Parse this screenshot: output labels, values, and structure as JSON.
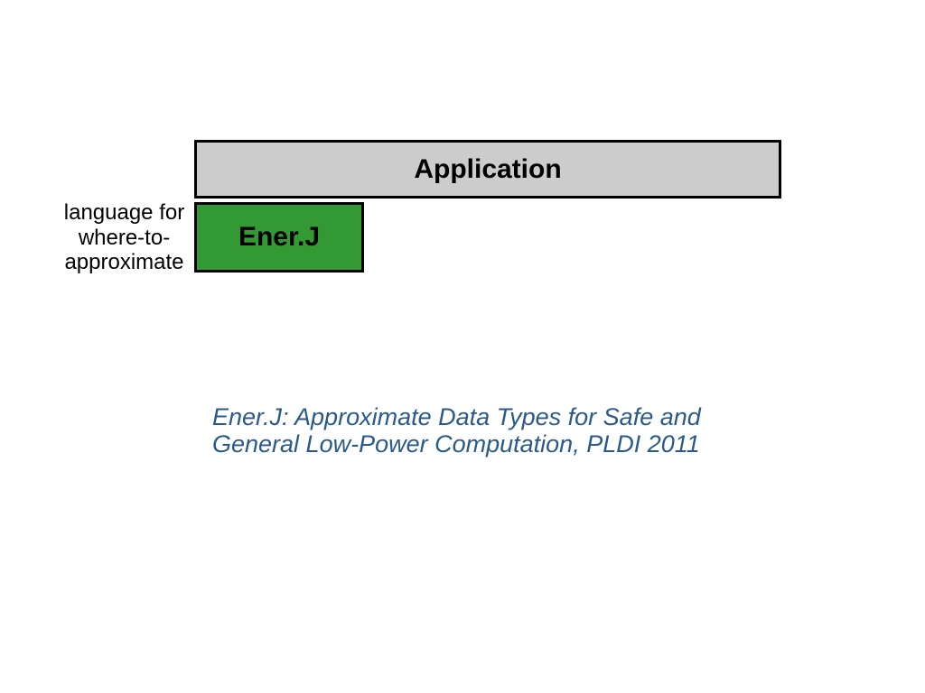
{
  "boxes": {
    "application": "Application",
    "enerj": "Ener.J"
  },
  "caption": {
    "line1": "language for",
    "line2": "where-to-",
    "line3": "approximate"
  },
  "citation": "Ener.J: Approximate Data Types for Safe and General Low-Power Computation, PLDI 2011"
}
